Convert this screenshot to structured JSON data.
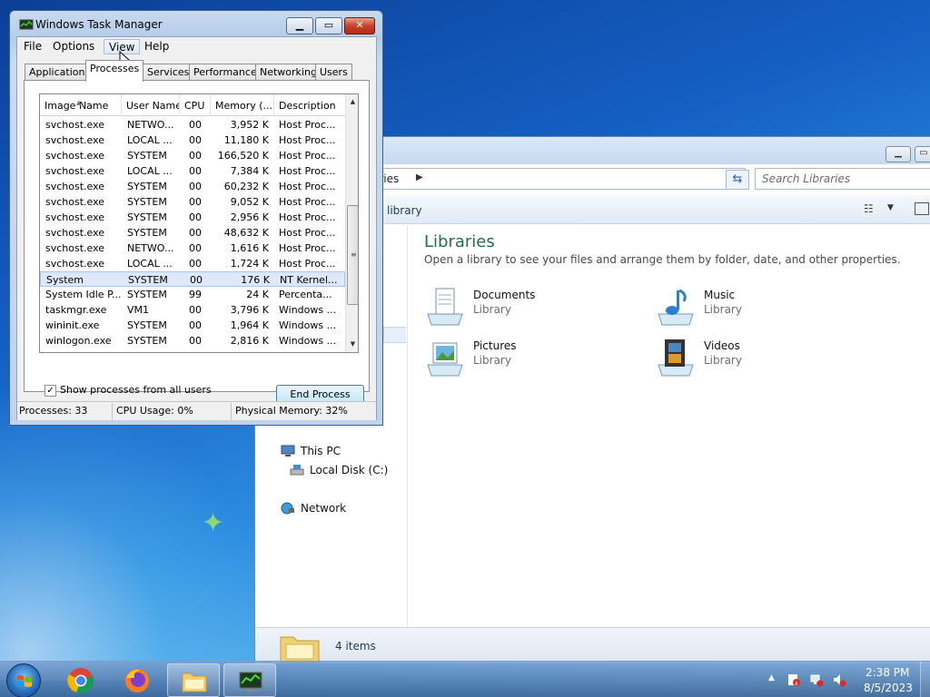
{
  "explorer": {
    "address_text": "aries",
    "search_placeholder": "Search Libraries",
    "toolbar_text": "library",
    "heading": "Libraries",
    "subheading": "Open a library to see your files and arrange them by folder, date, and other properties.",
    "libraries": [
      {
        "name": "Documents",
        "kind": "Library",
        "icon": "documents-library-icon"
      },
      {
        "name": "Music",
        "kind": "Library",
        "icon": "music-library-icon"
      },
      {
        "name": "Pictures",
        "kind": "Library",
        "icon": "pictures-library-icon"
      },
      {
        "name": "Videos",
        "kind": "Library",
        "icon": "videos-library-icon"
      }
    ],
    "nav": {
      "this_pc": "This PC",
      "local_disk": "Local Disk (C:)",
      "network": "Network"
    },
    "status_items": "4 items"
  },
  "taskmgr": {
    "title": "Windows Task Manager",
    "menu": [
      "File",
      "Options",
      "View",
      "Help"
    ],
    "tabs": [
      "Applications",
      "Processes",
      "Services",
      "Performance",
      "Networking",
      "Users"
    ],
    "active_tab": "Processes",
    "columns": [
      "Image Name",
      "User Name",
      "CPU",
      "Memory (...",
      "Description"
    ],
    "rows": [
      [
        "svchost.exe",
        "NETWO...",
        "00",
        "3,952 K",
        "Host Proc..."
      ],
      [
        "svchost.exe",
        "LOCAL ...",
        "00",
        "11,180 K",
        "Host Proc..."
      ],
      [
        "svchost.exe",
        "SYSTEM",
        "00",
        "166,520 K",
        "Host Proc..."
      ],
      [
        "svchost.exe",
        "LOCAL ...",
        "00",
        "7,384 K",
        "Host Proc..."
      ],
      [
        "svchost.exe",
        "SYSTEM",
        "00",
        "60,232 K",
        "Host Proc..."
      ],
      [
        "svchost.exe",
        "SYSTEM",
        "00",
        "9,052 K",
        "Host Proc..."
      ],
      [
        "svchost.exe",
        "SYSTEM",
        "00",
        "2,956 K",
        "Host Proc..."
      ],
      [
        "svchost.exe",
        "SYSTEM",
        "00",
        "48,632 K",
        "Host Proc..."
      ],
      [
        "svchost.exe",
        "NETWO...",
        "00",
        "1,616 K",
        "Host Proc..."
      ],
      [
        "svchost.exe",
        "LOCAL ...",
        "00",
        "1,724 K",
        "Host Proc..."
      ],
      [
        "System",
        "SYSTEM",
        "00",
        "176 K",
        "NT Kernel..."
      ],
      [
        "System Idle P...",
        "SYSTEM",
        "99",
        "24 K",
        "Percenta..."
      ],
      [
        "taskmgr.exe",
        "VM1",
        "00",
        "3,796 K",
        "Windows ..."
      ],
      [
        "wininit.exe",
        "SYSTEM",
        "00",
        "1,964 K",
        "Windows ..."
      ],
      [
        "winlogon.exe",
        "SYSTEM",
        "00",
        "2,816 K",
        "Windows ..."
      ]
    ],
    "selected_row": 10,
    "show_all_label": "Show processes from all users",
    "show_all_checked": true,
    "end_process_label": "End Process",
    "status": {
      "processes": "Processes: 33",
      "cpu": "CPU Usage: 0%",
      "memory": "Physical Memory: 32%"
    }
  },
  "taskbar": {
    "apps": [
      "chrome-icon",
      "firefox-icon",
      "file-explorer-icon",
      "task-manager-icon"
    ],
    "time": "2:38 PM",
    "date": "8/5/2023"
  },
  "colors": {
    "accent_green": "#1e7145",
    "selection": "#dde9f8",
    "close_red": "#c7412b"
  }
}
